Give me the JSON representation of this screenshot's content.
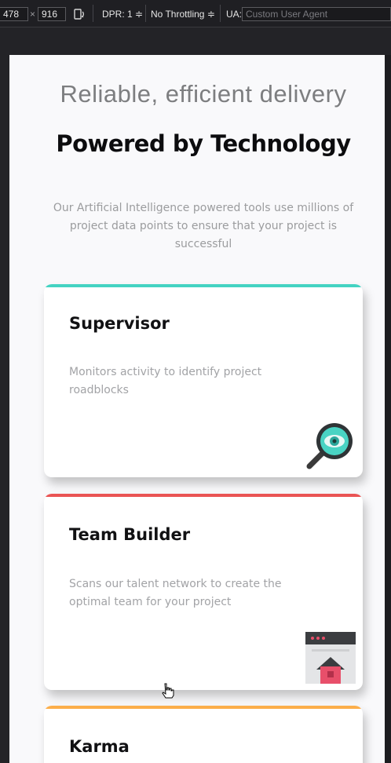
{
  "devtools": {
    "width_value": "478",
    "times_sign": "×",
    "height_value": "916",
    "dpr": "DPR: 1 ≑",
    "throttling": "No Throttling ≑",
    "ua_label": "UA:",
    "ua_placeholder": "Custom User Agent"
  },
  "hero": {
    "subtitle": "Reliable, efficient delivery",
    "title": "Powered by Technology",
    "description": "Our Artificial Intelligence powered tools use millions of project data points to ensure that your project is successful"
  },
  "cards": [
    {
      "title": "Supervisor",
      "description": "Monitors activity to identify project roadblocks",
      "accent": "#44d3c2",
      "icon": "magnifier-eye-icon"
    },
    {
      "title": "Team Builder",
      "description": "Scans our talent network to create the optimal team for your project",
      "accent": "#ea5454",
      "icon": "browser-home-icon"
    },
    {
      "title": "Karma",
      "description": "",
      "accent": "#fcae4a",
      "icon": ""
    }
  ]
}
